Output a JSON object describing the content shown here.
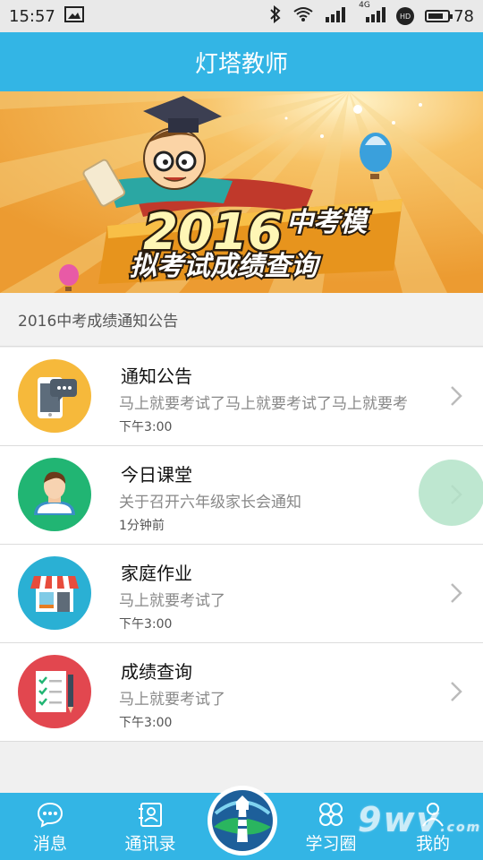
{
  "status_bar": {
    "time": "15:57",
    "network_label": "4G",
    "hd_label": "HD",
    "battery": "78",
    "battery_level": 0.78
  },
  "header": {
    "title": "灯塔教师"
  },
  "banner": {
    "year": "2016",
    "tag": "中考模",
    "headline": "拟考试成绩查询"
  },
  "notice": {
    "text": "2016中考成绩通知公告"
  },
  "list": {
    "items": [
      {
        "title": "通知公告",
        "subtitle": "马上就要考试了马上就要考试了马上就要考",
        "time": "下午3:00",
        "icon": "phone-chat-icon",
        "color": "#f6b93b"
      },
      {
        "title": "今日课堂",
        "subtitle": "关于召开六年级家长会通知",
        "time": "1分钟前",
        "icon": "student-avatar-icon",
        "color": "#21b573"
      },
      {
        "title": "家庭作业",
        "subtitle": "马上就要考试了",
        "time": "下午3:00",
        "icon": "storefront-icon",
        "color": "#2ab0d4"
      },
      {
        "title": "成绩查询",
        "subtitle": "马上就要考试了",
        "time": "下午3:00",
        "icon": "report-pencil-icon",
        "color": "#e2474f"
      }
    ]
  },
  "bottom_nav": {
    "messages": "消息",
    "contacts": "通讯录",
    "study": "学习圈",
    "mine": "我的"
  },
  "watermark": {
    "text": "9wv",
    "suffix": ".com"
  },
  "colors": {
    "accent": "#33b5e5"
  }
}
